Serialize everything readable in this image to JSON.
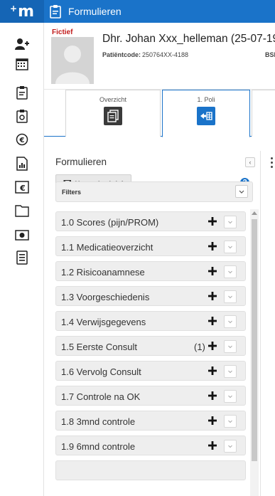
{
  "app": {
    "logo_text": "m",
    "module_title": "Formulieren"
  },
  "patient": {
    "flag": "Fictief",
    "name": "Dhr. Johan Xxx_helleman  (25-07-19",
    "code_label": "Patiëntcode:",
    "code_value": "250764XX-4188",
    "bsn_label": "BSN"
  },
  "tabs": [
    {
      "label": "Overzicht",
      "icon": "document-stack-icon",
      "active": false
    },
    {
      "label": "1. Poli",
      "icon": "poli-icon",
      "active": true
    }
  ],
  "panel": {
    "title": "Formulieren",
    "collapse_glyph": "‹",
    "send_button_label": "Verzenden brief",
    "help_glyph": "?",
    "filters_label": "Filters"
  },
  "forms": [
    {
      "label": "1.0 Scores (pijn/PROM)",
      "count": ""
    },
    {
      "label": "1.1 Medicatieoverzicht",
      "count": ""
    },
    {
      "label": "1.2 Risicoanamnese",
      "count": ""
    },
    {
      "label": "1.3 Voorgeschiedenis",
      "count": ""
    },
    {
      "label": "1.4 Verwijsgegevens",
      "count": ""
    },
    {
      "label": "1.5 Eerste Consult",
      "count": "(1)"
    },
    {
      "label": "1.6 Vervolg Consult",
      "count": ""
    },
    {
      "label": "1.7 Controle na OK",
      "count": ""
    },
    {
      "label": "1.8 3mnd controle",
      "count": ""
    },
    {
      "label": "1.9 6mnd controle",
      "count": ""
    },
    {
      "label": "",
      "count": ""
    }
  ],
  "colors": {
    "brand_blue": "#1a73c9",
    "flag_red": "#c21d1d"
  },
  "rail_icons": [
    "add-user-icon",
    "calendar-icon",
    "clipboard-icon",
    "clipboard-settings-icon",
    "euro-icon",
    "chart-document-icon",
    "euro-document-icon",
    "folder-icon",
    "camera-icon",
    "list-document-icon"
  ]
}
